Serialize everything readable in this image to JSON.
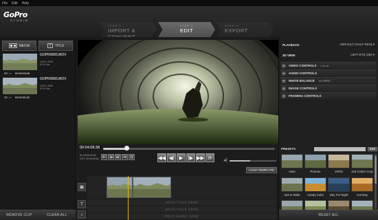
{
  "menu": [
    "File",
    "Edit",
    "Help"
  ],
  "logo": {
    "brand": "GoPro",
    "sub": "STUDIO"
  },
  "steps": [
    {
      "num": "STEP 1",
      "label": "IMPORT & CONVERT"
    },
    {
      "num": "STEP 2",
      "label": "EDIT"
    },
    {
      "num": "STEP 3",
      "label": "EXPORT"
    }
  ],
  "left": {
    "tab_media": "MEDIA",
    "tab_title": "TITLE",
    "clips": [
      {
        "name": "GOPR0065.MOV",
        "res": "1920 x 1080",
        "fps": "59.94 fps",
        "tag": "2D",
        "gp": "GP",
        "duration": "00:00:08.08"
      },
      {
        "name": "GOPR0066.MOV",
        "res": "1920 x 1080",
        "fps": "59.94 fps",
        "tag": "2D",
        "gp": "GP",
        "duration": "00:02:35.32"
      }
    ],
    "remove_clip": "REMOVE CLIP",
    "clear_all": "CLEAR ALL"
  },
  "center": {
    "timecode": "00:04:08.38",
    "in_label": "IN: 00:00:00.00",
    "out_label": "OUT: 00:04:08.38",
    "load_template": "LOAD TEMPLATE",
    "drag_title_1": "DRAG TITLE HERE",
    "drag_title_2": "DRAG TITLE HERE",
    "drag_audio": "DRAG AUDIO HERE"
  },
  "right": {
    "playback_label": "PLAYBACK",
    "playback_value": "DEFAULT (HALF-RES)",
    "view3d_label": "3D VIEW",
    "view3d_value": "LEFT EYE (2D)",
    "controls": [
      {
        "label": "VIDEO CONTROLS",
        "extra": "• ••• •••"
      },
      {
        "label": "AUDIO CONTROLS",
        "extra": ""
      },
      {
        "label": "WHITE BALANCE",
        "extra": "•••• PROI"
      },
      {
        "label": "IMAGE CONTROLS",
        "extra": ""
      },
      {
        "label": "FRAMING CONTROLS",
        "extra": ""
      }
    ],
    "presets_label": "PRESETS",
    "add_label": "ADD",
    "presets": [
      "none",
      "Protune",
      "1970s",
      "4x3 Center Crop",
      "4x3 to Wide",
      "Candy Color",
      "Day For Night",
      "Hot Day",
      "",
      "",
      "",
      ""
    ],
    "reset_all": "RESET ALL"
  },
  "colors": {
    "accent": "#e8b800",
    "background": "#1b1b1b"
  }
}
